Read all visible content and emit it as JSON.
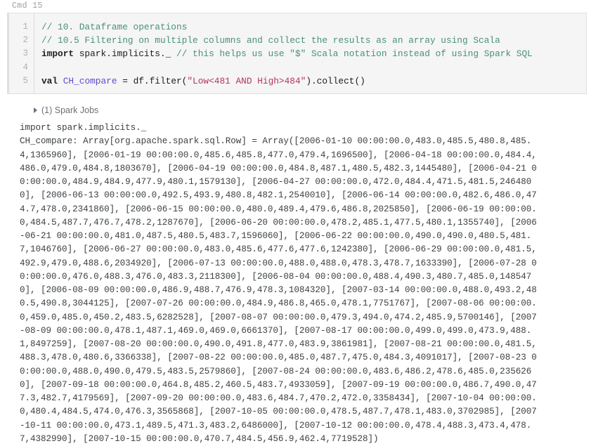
{
  "cell": {
    "label": "Cmd 15",
    "accent_color": "#8fce8f",
    "editor_bg": "#f5f5f5",
    "output_color": "#3c4043"
  },
  "code": {
    "line_numbers": [
      "1",
      "2",
      "3",
      "4",
      "5"
    ],
    "lines": [
      {
        "n": "1",
        "tokens": [
          {
            "t": "// 10. Dataframe operations",
            "c": "tok-comment"
          }
        ]
      },
      {
        "n": "2",
        "tokens": [
          {
            "t": "// 10.5 Filtering on multiple columns and collect the results as an array using Scala",
            "c": "tok-comment"
          }
        ]
      },
      {
        "n": "3",
        "tokens": [
          {
            "t": "import",
            "c": "tok-keyword"
          },
          {
            "t": " spark.implicits._ ",
            "c": "tok-plain"
          },
          {
            "t": "// this helps us use \"$\" Scala notation instead of using Spark SQL",
            "c": "tok-comment"
          }
        ]
      },
      {
        "n": "4",
        "tokens": [
          {
            "t": "",
            "c": "tok-plain"
          }
        ]
      },
      {
        "n": "5",
        "tokens": [
          {
            "t": "val",
            "c": "tok-keyword"
          },
          {
            "t": " ",
            "c": "tok-plain"
          },
          {
            "t": "CH_compare",
            "c": "tok-var"
          },
          {
            "t": " = df.filter(",
            "c": "tok-plain"
          },
          {
            "t": "\"Low<481 AND High>484\"",
            "c": "tok-string"
          },
          {
            "t": ").collect()",
            "c": "tok-plain"
          }
        ]
      }
    ]
  },
  "results": {
    "spark_jobs_label": "(1) Spark Jobs",
    "disclosure_state": "collapsed",
    "output_lines": [
      "import spark.implicits._",
      "CH_compare: Array[org.apache.spark.sql.Row] = Array([2006-01-10 00:00:00.0,483.0,485.5,480.8,485.",
      "4,1365960], [2006-01-19 00:00:00.0,485.6,485.8,477.0,479.4,1696500], [2006-04-18 00:00:00.0,484.4,",
      "486.0,479.0,484.8,1803670], [2006-04-19 00:00:00.0,484.8,487.1,480.5,482.3,1445480], [2006-04-21 0",
      "0:00:00.0,484.9,484.9,477.9,480.1,1579130], [2006-04-27 00:00:00.0,472.0,484.4,471.5,481.5,246480",
      "0], [2006-06-13 00:00:00.0,492.5,493.9,480.8,482.1,2540010], [2006-06-14 00:00:00.0,482.6,486.0,47",
      "4.7,478.0,2341860], [2006-06-15 00:00:00.0,480.0,489.4,479.6,486.8,2025850], [2006-06-19 00:00:00.",
      "0,484.5,487.7,476.7,478.2,1287670], [2006-06-20 00:00:00.0,478.2,485.1,477.5,480.1,1355740], [2006",
      "-06-21 00:00:00.0,481.0,487.5,480.5,483.7,1596060], [2006-06-22 00:00:00.0,490.0,490.0,480.5,481.",
      "7,1046760], [2006-06-27 00:00:00.0,483.0,485.6,477.6,477.6,1242380], [2006-06-29 00:00:00.0,481.5,",
      "492.9,479.0,488.6,2034920], [2006-07-13 00:00:00.0,488.0,488.0,478.3,478.7,1633390], [2006-07-28 0",
      "0:00:00.0,476.0,488.3,476.0,483.3,2118300], [2006-08-04 00:00:00.0,488.4,490.3,480.7,485.0,148547",
      "0], [2006-08-09 00:00:00.0,486.9,488.7,476.9,478.3,1084320], [2007-03-14 00:00:00.0,488.0,493.2,48",
      "0.5,490.8,3044125], [2007-07-26 00:00:00.0,484.9,486.8,465.0,478.1,7751767], [2007-08-06 00:00:00.",
      "0,459.0,485.0,450.2,483.5,6282528], [2007-08-07 00:00:00.0,479.3,494.0,474.2,485.9,5700146], [2007",
      "-08-09 00:00:00.0,478.1,487.1,469.0,469.0,6661370], [2007-08-17 00:00:00.0,499.0,499.0,473.9,488.",
      "1,8497259], [2007-08-20 00:00:00.0,490.0,491.8,477.0,483.9,3861981], [2007-08-21 00:00:00.0,481.5,",
      "488.3,478.0,480.6,3366338], [2007-08-22 00:00:00.0,485.0,487.7,475.0,484.3,4091017], [2007-08-23 0",
      "0:00:00.0,488.0,490.0,479.5,483.5,2579860], [2007-08-24 00:00:00.0,483.6,486.2,478.6,485.0,235626",
      "0], [2007-09-18 00:00:00.0,464.8,485.2,460.5,483.7,4933059], [2007-09-19 00:00:00.0,486.7,490.0,47",
      "7.3,482.7,4179569], [2007-09-20 00:00:00.0,483.6,484.7,470.2,472.0,3358434], [2007-10-04 00:00:00.",
      "0,480.4,484.5,474.0,476.3,3565868], [2007-10-05 00:00:00.0,478.5,487.7,478.1,483.0,3702985], [2007",
      "-10-11 00:00:00.0,473.1,489.5,471.3,483.2,6486000], [2007-10-12 00:00:00.0,478.4,488.3,473.4,478.",
      "7,4382990], [2007-10-15 00:00:00.0,470.7,484.5,456.9,462.4,7719528])"
    ]
  }
}
